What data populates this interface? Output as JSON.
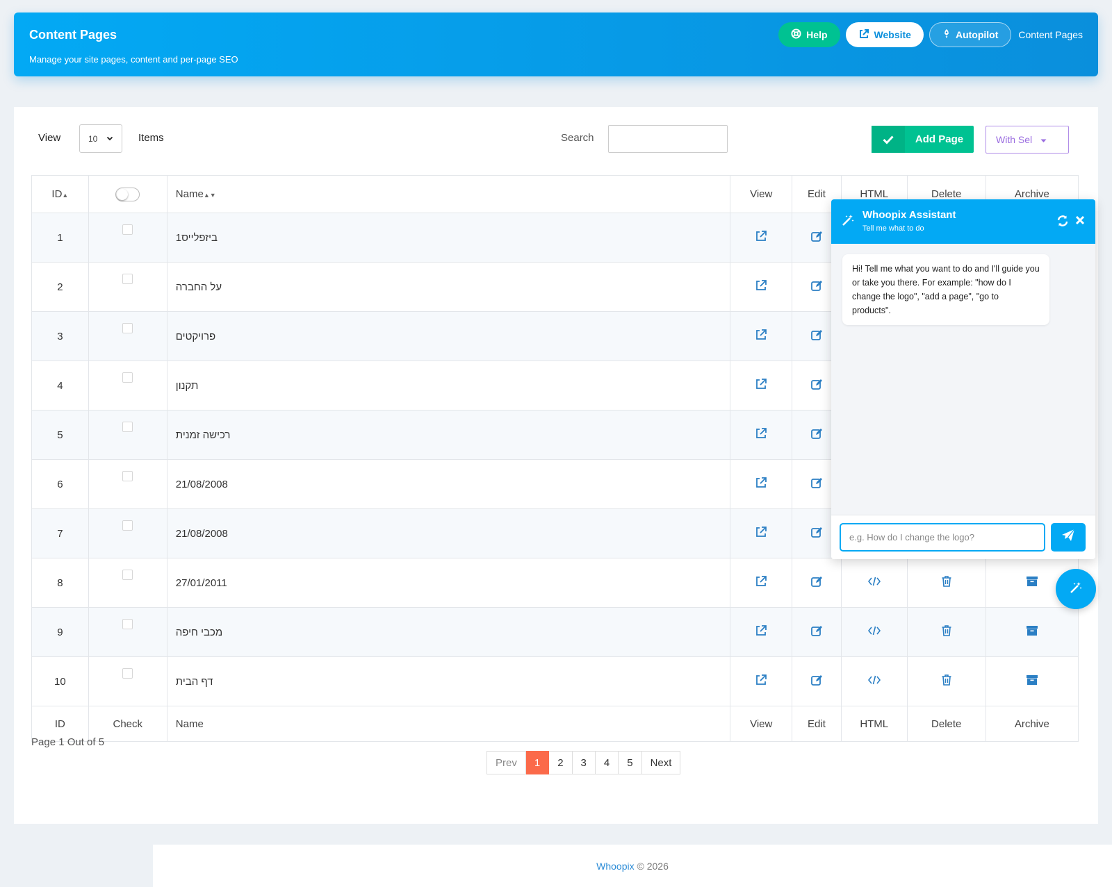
{
  "header": {
    "title": "Content Pages",
    "subtitle": "Manage your site pages, content and per-page SEO",
    "help_label": "Help",
    "website_label": "Website",
    "autopilot_label": "Autopilot",
    "breadcrumb": "Content Pages"
  },
  "toolbar": {
    "view_label": "View",
    "items_per_page": "10",
    "items_label": "Items",
    "search_label": "Search",
    "search_value": "",
    "add_label": "Add Page",
    "with_selected_label": "With Sel"
  },
  "table": {
    "head": {
      "id": "ID",
      "name": "Name",
      "view": "View",
      "edit": "Edit",
      "html": "HTML",
      "delete": "Delete",
      "archive": "Archive"
    },
    "foot": {
      "id": "ID",
      "check": "Check",
      "name": "Name",
      "view": "View",
      "edit": "Edit",
      "html": "HTML",
      "delete": "Delete",
      "archive": "Archive"
    },
    "rows": [
      {
        "id": "1",
        "name": "ביזפלייס1"
      },
      {
        "id": "2",
        "name": "על החברה"
      },
      {
        "id": "3",
        "name": "פרויקטים"
      },
      {
        "id": "4",
        "name": "תקנון"
      },
      {
        "id": "5",
        "name": "רכישה זמנית"
      },
      {
        "id": "6",
        "name": "21/08/2008"
      },
      {
        "id": "7",
        "name": "21/08/2008"
      },
      {
        "id": "8",
        "name": "27/01/2011"
      },
      {
        "id": "9",
        "name": "מכבי חיפה"
      },
      {
        "id": "10",
        "name": "דף הבית"
      }
    ]
  },
  "pagination": {
    "info": "Page 1 Out of 5",
    "prev": "Prev",
    "pages": [
      "1",
      "2",
      "3",
      "4",
      "5"
    ],
    "next": "Next",
    "current": "1"
  },
  "footer": {
    "brand": "Whoopix",
    "copyright": "© 2026"
  },
  "assistant": {
    "title": "Whoopix Assistant",
    "subtitle": "Tell me what to do",
    "message": "Hi! Tell me what you want to do and I'll guide you or take you there. For example: \"how do I change the logo\", \"add a page\", \"go to products\".",
    "input_placeholder": "e.g. How do I change the logo?"
  },
  "colors": {
    "primary": "#03a9f4",
    "success": "#00c292",
    "danger_active_page": "#fb6a4a",
    "icon": "#2b7fc4"
  }
}
